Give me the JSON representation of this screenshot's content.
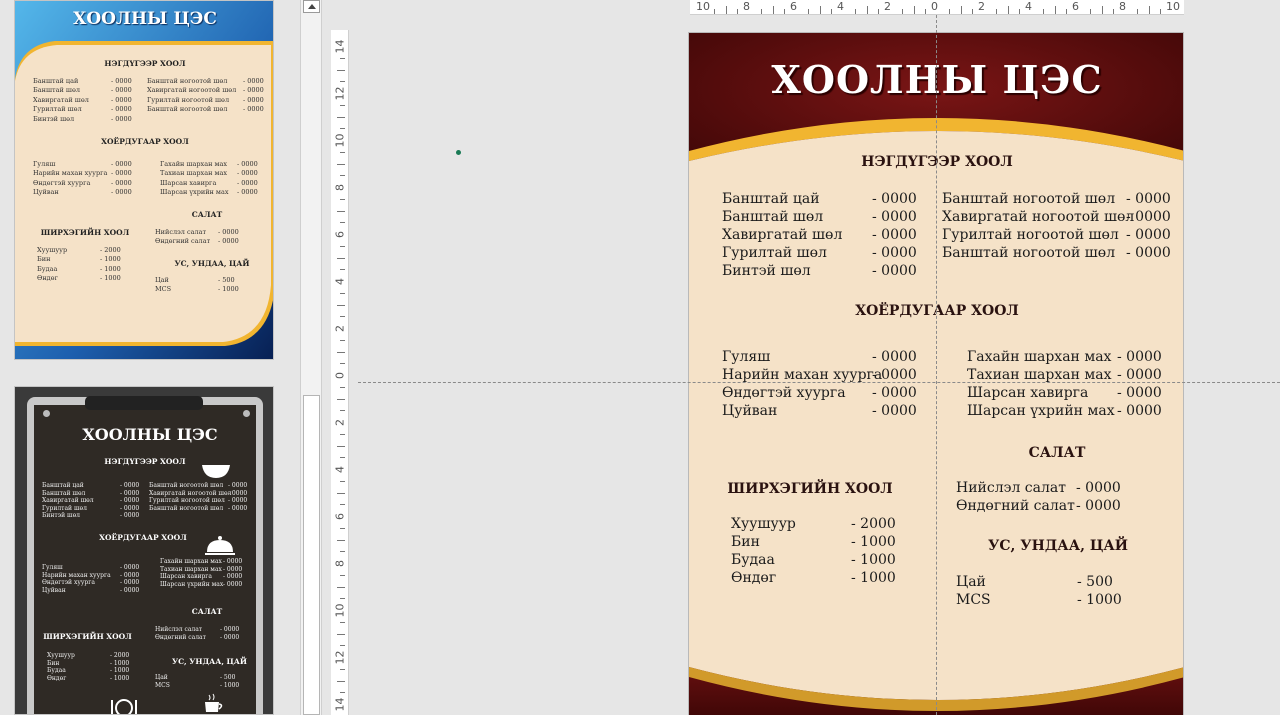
{
  "menu": {
    "title": "ХООЛНЫ ЦЭС",
    "section1": {
      "heading": "НЭГДҮГЭЭР ХООЛ",
      "left": [
        {
          "name": "Банштай цай",
          "price": "- 0000"
        },
        {
          "name": "Банштай шөл",
          "price": "- 0000"
        },
        {
          "name": "Хавиргатай шөл",
          "price": "- 0000"
        },
        {
          "name": "Гурилтай шөл",
          "price": "- 0000"
        },
        {
          "name": "Бинтэй шөл",
          "price": "- 0000"
        }
      ],
      "right": [
        {
          "name": "Банштай ногоотой шөл",
          "price": "- 0000"
        },
        {
          "name": "Хавиргатай ногоотой шөл",
          "price": "- 0000"
        },
        {
          "name": "Гурилтай ногоотой шөл",
          "price": "- 0000"
        },
        {
          "name": "Банштай ногоотой шөл",
          "price": "- 0000"
        }
      ]
    },
    "section2": {
      "heading": "ХОЁРДУГААР ХООЛ",
      "left": [
        {
          "name": "Гуляш",
          "price": "- 0000"
        },
        {
          "name": "Нарийн махан хуурга",
          "price": "- 0000"
        },
        {
          "name": "Өндөгтэй хуурга",
          "price": "- 0000"
        },
        {
          "name": "Цуйван",
          "price": "- 0000"
        }
      ],
      "right": [
        {
          "name": "Гахайн шархан мах",
          "price": "- 0000"
        },
        {
          "name": "Тахиан шархан мах",
          "price": "- 0000"
        },
        {
          "name": "Шарсан хавирга",
          "price": "- 0000"
        },
        {
          "name": "Шарсан үхрийн мах",
          "price": "- 0000"
        }
      ]
    },
    "salad": {
      "heading": "САЛАТ",
      "items": [
        {
          "name": "Нийслэл салат",
          "price": "- 0000"
        },
        {
          "name": "Өндөгний салат",
          "price": "- 0000"
        }
      ]
    },
    "grill": {
      "heading": "ШИРХЭГИЙН ХООЛ",
      "items": [
        {
          "name": "Хуушуур",
          "price": "- 2000"
        },
        {
          "name": "Бин",
          "price": "- 1000"
        },
        {
          "name": "Будаа",
          "price": "- 1000"
        },
        {
          "name": "Өндөг",
          "price": "- 1000"
        }
      ]
    },
    "drinks": {
      "heading": "УС, УНДАА, ЦАЙ",
      "items": [
        {
          "name": "Цай",
          "price": "- 500"
        },
        {
          "name": "MCS",
          "price": "- 1000"
        }
      ]
    }
  },
  "ruler": {
    "h_labels": [
      "10",
      "8",
      "6",
      "4",
      "2",
      "0",
      "2",
      "4",
      "6",
      "8",
      "10"
    ],
    "v_labels": [
      "14",
      "12",
      "10",
      "8",
      "6",
      "4",
      "2",
      "0",
      "2",
      "4",
      "6",
      "8",
      "10",
      "12",
      "14"
    ]
  },
  "colors": {
    "maroon": "#5a0d0d",
    "cream": "#f5e2c8",
    "gold": "#f1b530",
    "blue": "#1e6fbf",
    "chalk": "#2f2a25"
  }
}
